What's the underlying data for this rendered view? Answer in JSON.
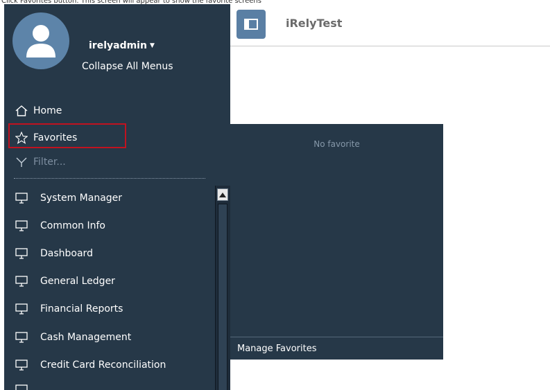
{
  "caption": "Click Favorites button. This screen will appear to show the favorite screens",
  "user": {
    "name": "irelyadmin",
    "collapse_label": "Collapse All Menus"
  },
  "nav": {
    "home": "Home",
    "favorites": "Favorites",
    "filter_placeholder": "Filter..."
  },
  "menu": [
    {
      "label": "System Manager"
    },
    {
      "label": "Common Info"
    },
    {
      "label": "Dashboard"
    },
    {
      "label": "General Ledger"
    },
    {
      "label": "Financial Reports"
    },
    {
      "label": "Cash Management"
    },
    {
      "label": "Credit Card Reconciliation"
    }
  ],
  "topbar": {
    "title": "iRelyTest"
  },
  "favorites_panel": {
    "empty_text": "No favorite",
    "manage_label": "Manage Favorites"
  },
  "colors": {
    "sidebar_bg": "#263848",
    "avatar_bg": "#5d84a9",
    "highlight": "#c1121f",
    "topbar_button": "#5a7fa4"
  }
}
